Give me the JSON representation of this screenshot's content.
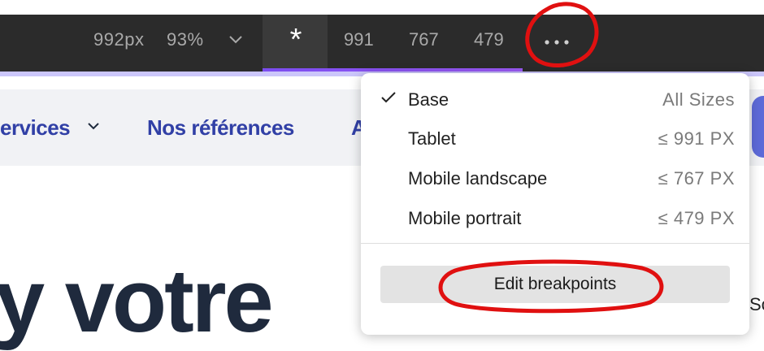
{
  "toolbar": {
    "size_label": "992px",
    "zoom_label": "93%",
    "base_icon": "*",
    "breakpoints": [
      "991",
      "767",
      "479"
    ],
    "more_icon": "more-horizontal-icon"
  },
  "nav": {
    "services": "ervices",
    "references": "Nos références",
    "partial": "A"
  },
  "hero": {
    "text": "y votre"
  },
  "edge_text": "Sc",
  "menu": {
    "items": [
      {
        "label": "Base",
        "size": "All Sizes",
        "checked": true
      },
      {
        "label": "Tablet",
        "size": "≤ 991 PX",
        "checked": false
      },
      {
        "label": "Mobile landscape",
        "size": "≤ 767 PX",
        "checked": false
      },
      {
        "label": "Mobile portrait",
        "size": "≤ 479 PX",
        "checked": false
      }
    ],
    "edit_label": "Edit breakpoints"
  },
  "colors": {
    "toolbar_bg": "#2b2b2b",
    "accent_underline": "#7b4cf0",
    "nav_link": "#3140a6",
    "annotation": "#e01010"
  }
}
